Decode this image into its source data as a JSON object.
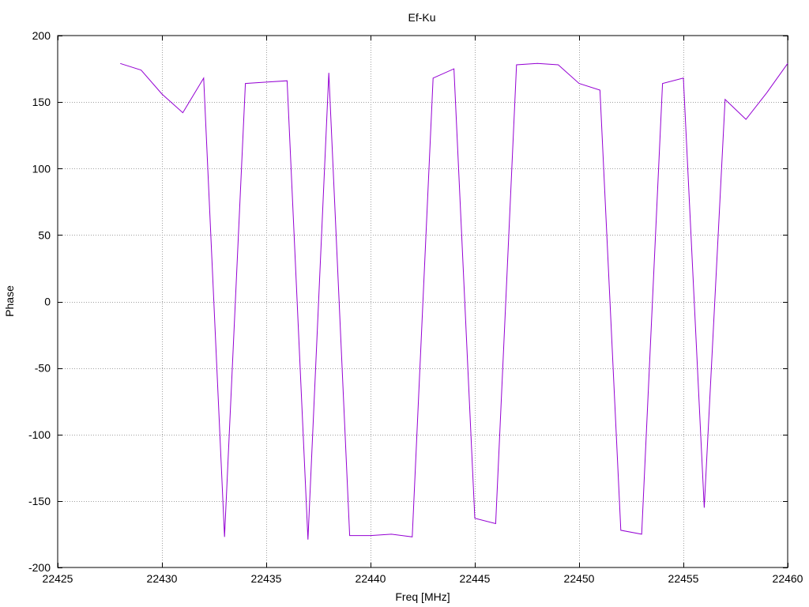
{
  "chart_data": {
    "type": "line",
    "title": "Ef-Ku",
    "xlabel": "Freq [MHz]",
    "ylabel": "Phase",
    "xlim": [
      22425,
      22460
    ],
    "ylim": [
      -200,
      200
    ],
    "xticks": [
      22425,
      22430,
      22435,
      22440,
      22445,
      22450,
      22455,
      22460
    ],
    "yticks": [
      -200,
      -150,
      -100,
      -50,
      0,
      50,
      100,
      150,
      200
    ],
    "grid": true,
    "series": [
      {
        "color": "#9400d3",
        "x": [
          22428,
          22429,
          22430,
          22431,
          22432,
          22433,
          22434,
          22435,
          22436,
          22437,
          22438,
          22439,
          22440,
          22441,
          22442,
          22443,
          22444,
          22445,
          22446,
          22447,
          22448,
          22449,
          22450,
          22451,
          22452,
          22453,
          22454,
          22455,
          22456,
          22457,
          22458,
          22459,
          22460
        ],
        "y": [
          179,
          174,
          156,
          142,
          168,
          -177,
          164,
          165,
          166,
          -179,
          172,
          -176,
          -176,
          -175,
          -177,
          168,
          175,
          -163,
          -167,
          178,
          179,
          178,
          164,
          159,
          -172,
          -175,
          164,
          168,
          -155,
          152,
          137,
          157,
          179
        ]
      }
    ]
  }
}
